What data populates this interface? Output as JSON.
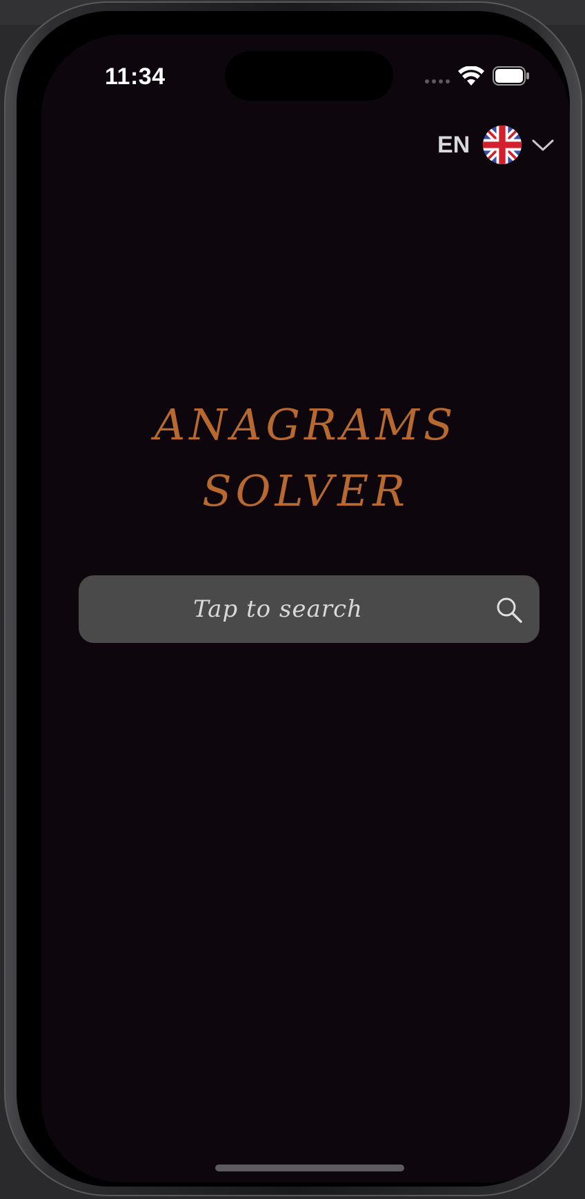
{
  "status_bar": {
    "time": "11:34",
    "wifi_icon": "wifi-icon",
    "battery_icon": "battery-icon"
  },
  "language": {
    "code": "EN",
    "flag_icon": "uk-flag-icon",
    "chevron_icon": "chevron-down-icon"
  },
  "title": {
    "line1": "ANAGRAMS",
    "line2": "SOLVER",
    "color": "#b8692f"
  },
  "search": {
    "placeholder": "Tap to search",
    "icon": "search-icon",
    "background": "#4a4a4a"
  },
  "colors": {
    "screen_background": "#0d070d",
    "accent": "#b8692f"
  }
}
